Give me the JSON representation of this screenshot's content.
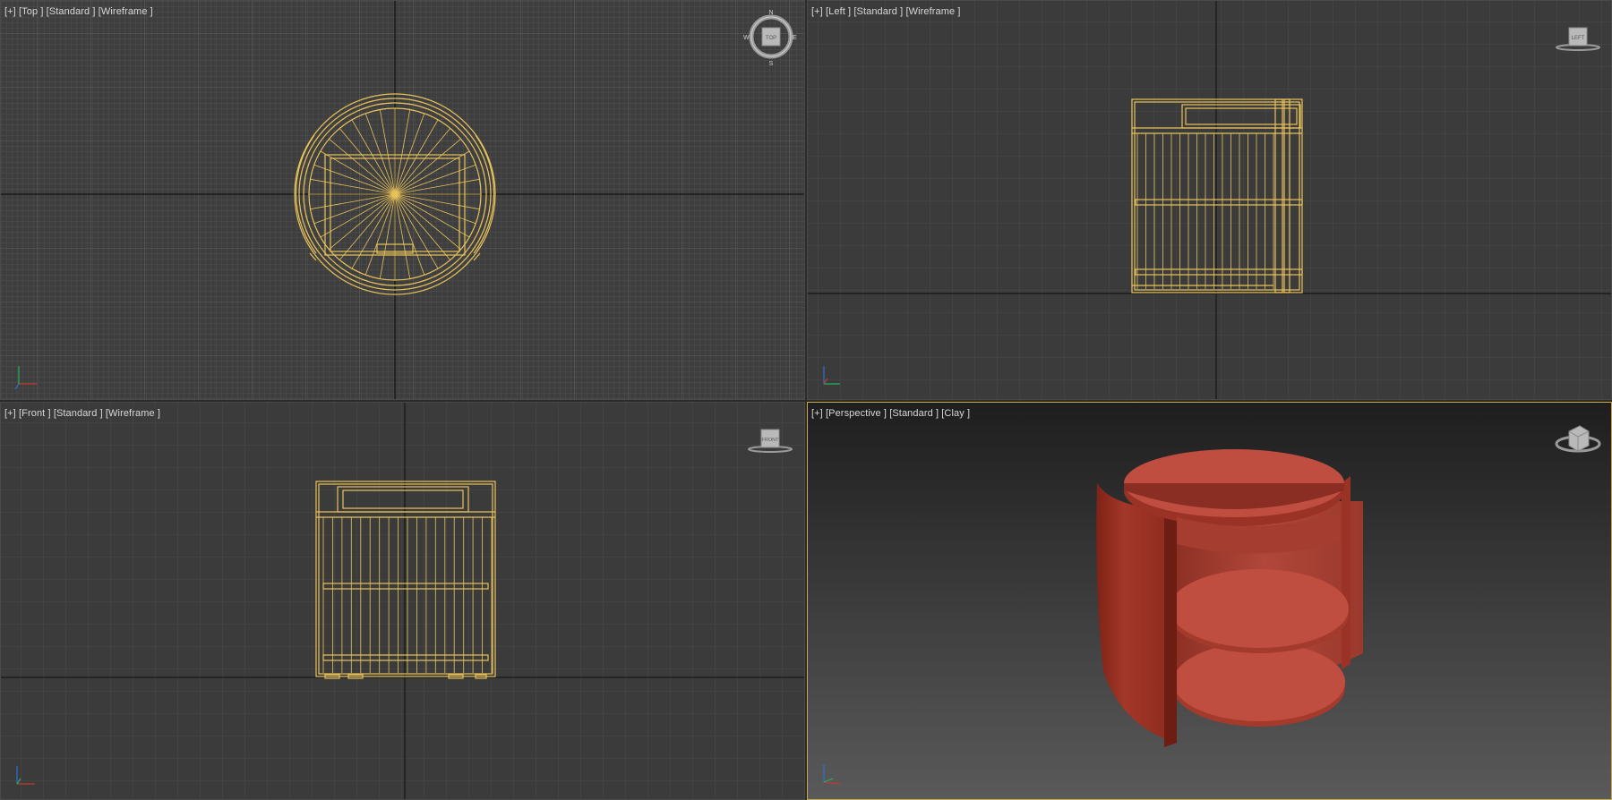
{
  "viewports": {
    "top": {
      "menu": "[+]",
      "view": "[Top ]",
      "shading": "[Standard ]",
      "mode": "[Wireframe ]",
      "cube_label": "TOP"
    },
    "left": {
      "menu": "[+]",
      "view": "[Left ]",
      "shading": "[Standard ]",
      "mode": "[Wireframe ]",
      "cube_label": "LEFT"
    },
    "front": {
      "menu": "[+]",
      "view": "[Front ]",
      "shading": "[Standard ]",
      "mode": "[Wireframe ]",
      "cube_label": "FRONT"
    },
    "persp": {
      "menu": "[+]",
      "view": "[Perspective ]",
      "shading": "[Standard ]",
      "mode": "[Clay ]"
    }
  },
  "compass": {
    "n": "N",
    "s": "S",
    "e": "E",
    "w": "W"
  },
  "colors": {
    "viewport_bg": "#3b3b3b",
    "grid": "#4a4a4a",
    "top_grid": "#555555",
    "home_grid": "#1c1c1c",
    "wireframe": "#e8c35a",
    "clay": "#b8483a",
    "active_border": "#c9a84a"
  },
  "icons": {
    "viewcube": "viewcube-icon",
    "axis": "axis-tripod-icon",
    "compass": "compass-ring-icon"
  }
}
